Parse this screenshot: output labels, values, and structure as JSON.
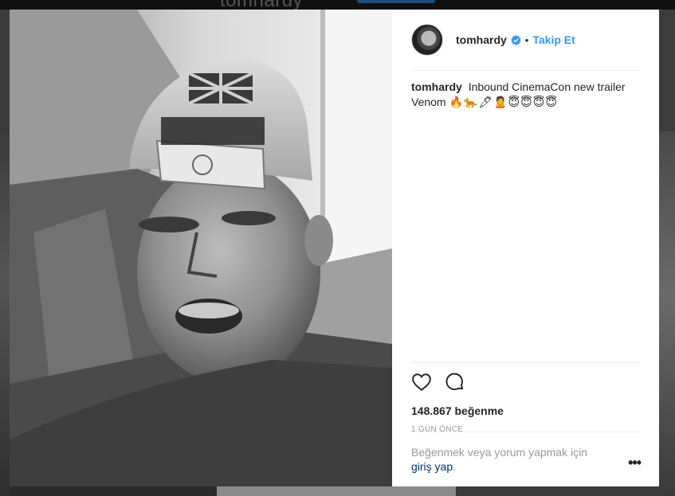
{
  "background": {
    "username": "tomhardy"
  },
  "post": {
    "username": "tomhardy",
    "follow_label": "Takip Et",
    "separator": "•",
    "caption": {
      "username": "tomhardy",
      "text": "Inbound CinemaCon new trailer Venom",
      "emojis": "🔥🐆🖊🙎😇😇😇😇"
    },
    "likes": "148.867 beğenme",
    "time": "1 GÜN ÖNCE",
    "login_prompt": {
      "text": "Beğenmek veya yorum yapmak için ",
      "link": "giriş yap",
      "end": "."
    },
    "more": "•••"
  },
  "colors": {
    "link": "#3897f0",
    "verified": "#3897f0",
    "text": "#262626",
    "muted": "#999999",
    "login_link": "#003569"
  },
  "icons": {
    "like": "heart-icon",
    "comment": "comment-icon",
    "verified": "verified-badge-icon",
    "more": "more-options-icon"
  }
}
